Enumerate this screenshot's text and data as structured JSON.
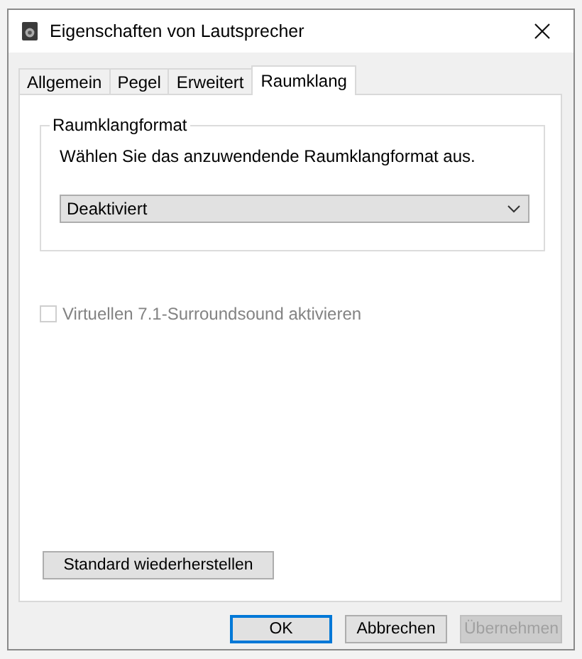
{
  "window": {
    "title": "Eigenschaften von Lautsprecher"
  },
  "tabs": [
    {
      "label": "Allgemein",
      "selected": false
    },
    {
      "label": "Pegel",
      "selected": false
    },
    {
      "label": "Erweitert",
      "selected": false
    },
    {
      "label": "Raumklang",
      "selected": true
    }
  ],
  "group": {
    "title": "Raumklangformat",
    "instruction": "Wählen Sie das anzuwendende Raumklangformat aus.",
    "dropdown": {
      "value": "Deaktiviert"
    }
  },
  "checkbox": {
    "label": "Virtuellen 7.1-Surroundsound aktivieren",
    "checked": false,
    "disabled": true
  },
  "restore_button": {
    "label": "Standard wiederherstellen"
  },
  "buttons": [
    {
      "label": "OK",
      "default": true,
      "disabled": false
    },
    {
      "label": "Abbrechen",
      "default": false,
      "disabled": false
    },
    {
      "label": "Übernehmen",
      "default": false,
      "disabled": true
    }
  ]
}
